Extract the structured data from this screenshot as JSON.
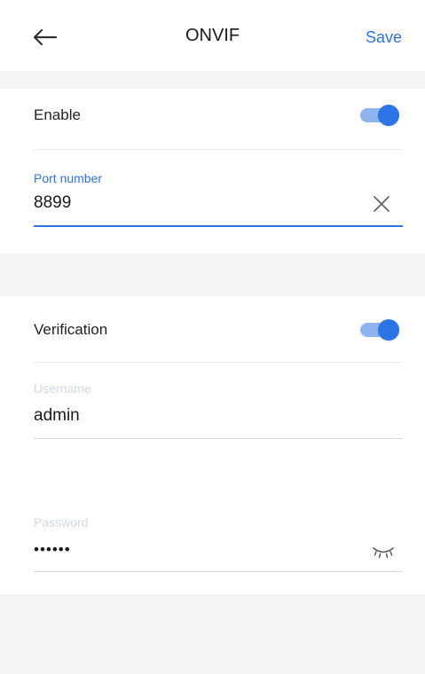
{
  "header": {
    "title": "ONVIF",
    "save_label": "Save",
    "back_icon": "arrow-left-icon"
  },
  "onvif": {
    "enable_label": "Enable",
    "enable_on": true,
    "port_label": "Port number",
    "port_value": "8899",
    "clear_icon": "close-icon"
  },
  "verification": {
    "label": "Verification",
    "enabled": true,
    "username_label": "Username",
    "username_value": "admin",
    "password_label": "Password",
    "password_value": "••••••",
    "eye_icon": "eye-closed-icon"
  },
  "colors": {
    "accent": "#2c73e6",
    "toggle_track": "#8fb4f0",
    "gap_background": "#f5f5f7"
  }
}
